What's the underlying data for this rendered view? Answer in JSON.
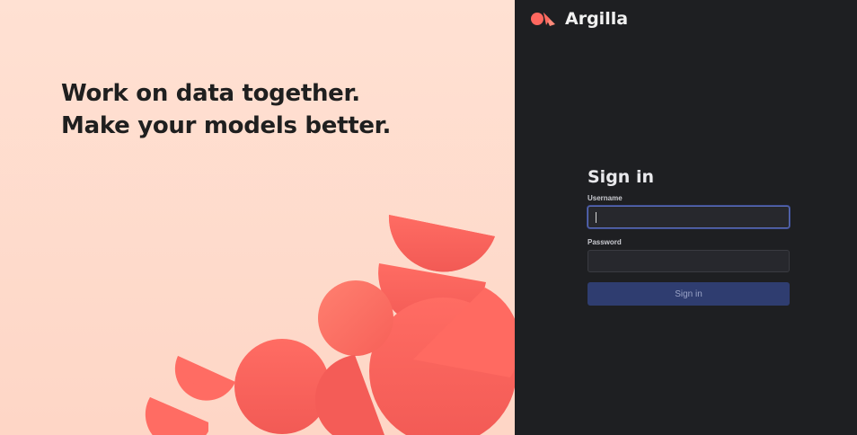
{
  "colors": {
    "accent": "#ff675f",
    "left_bg": "#ffe1d3",
    "right_bg": "#1e1f22",
    "button_bg": "#2f3d70"
  },
  "hero": {
    "line1": "Work on data together.",
    "line2": "Make your models better."
  },
  "brand": {
    "name": "Argilla",
    "logo_icon": "argilla-logo-icon"
  },
  "signin": {
    "title": "Sign in",
    "username_label": "Username",
    "username_value": "",
    "password_label": "Password",
    "password_value": "",
    "submit_label": "Sign in"
  }
}
